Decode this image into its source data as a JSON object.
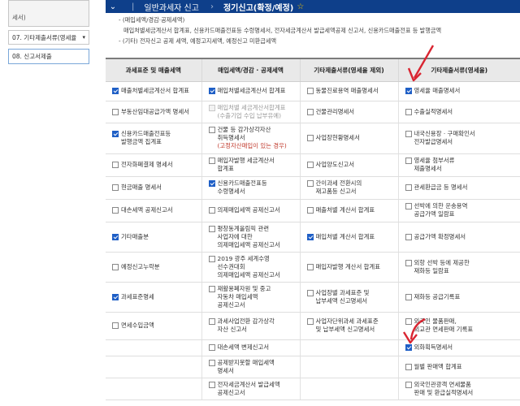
{
  "topbar": {
    "breadcrumb_1": "일반과세자 신고",
    "breadcrumb_2": "정기신고(확정/예정)"
  },
  "sidebar": {
    "item_top": "세서)",
    "item_7": "07. 기타제출서류(영세율",
    "item_8": "08. 신고서제출"
  },
  "notes": {
    "line1": "- (매입세액/경감·공제세액)",
    "line2": "매입처별세금계산서 합계표, 신용카드매출전표등 수령명세서, 전자세금계산서 발급세액공제 신고서, 신용카드매출전표 등 발행금액",
    "line3": "- (기타) 전자신고 공제 세액, 예정고지세액, 예정신고 미환급세액"
  },
  "table": {
    "headers": [
      "과세표준 및 매출세액",
      "매입세액/경감 · 공제세액",
      "기타제출서류(영세율 제외)",
      "기타제출서류(영세율)"
    ],
    "rows": [
      [
        {
          "label": "매출처별세금계산서 합계표",
          "checked": true
        },
        {
          "label": "매입처별세금계산서 합계표",
          "checked": true
        },
        {
          "label": "동물진료용역 매출명세서",
          "checked": false
        },
        {
          "label": "영세율 매출명세서",
          "checked": true
        }
      ],
      [
        {
          "label": "부동산임대공급가액 명세서",
          "checked": false
        },
        {
          "label": "매입처별 세금계산서합계표\n(수출기업 수입 납부유예)",
          "checked": false,
          "disabled": true
        },
        {
          "label": "건물관리명세서",
          "checked": false
        },
        {
          "label": "수출실적명세서",
          "checked": false
        }
      ],
      [
        {
          "label": "신용카드매출전표등\n발행금액 집계표",
          "checked": true
        },
        {
          "label": "건물 등 감가상각자산\n취득명세서",
          "sub": "(고정자산매입이 있는 경우)",
          "checked": false
        },
        {
          "label": "사업장현황명세서",
          "checked": false
        },
        {
          "label": "내국신용장 · 구매확인서\n전자발급명세서",
          "checked": false
        }
      ],
      [
        {
          "label": "전자화폐결제 명세서",
          "checked": false
        },
        {
          "label": "매입자발행 세금계산서\n합계표",
          "checked": false
        },
        {
          "label": "사업양도신고서",
          "checked": false
        },
        {
          "label": "영세율 첨부서류\n제출명세서",
          "checked": false
        }
      ],
      [
        {
          "label": "현금매출 명세서",
          "checked": false
        },
        {
          "label": "신용카드매출전표등\n수령명세서",
          "checked": true
        },
        {
          "label": "간이과세 전환시의\n재고품등 신고서",
          "checked": false
        },
        {
          "label": "관세환급금 등 명세서",
          "checked": false
        }
      ],
      [
        {
          "label": "대손세액 공제신고서",
          "checked": false
        },
        {
          "label": "의제매입세액 공제신고서",
          "checked": false
        },
        {
          "label": "매출처별 계산서 합계표",
          "checked": false
        },
        {
          "label": "선박에 의한 운송용역\n공급가액 일람표",
          "checked": false
        }
      ],
      [
        {
          "label": "기타매출분",
          "checked": true
        },
        {
          "label": "평창동계올림픽 관련\n사업자에 대한\n의제매입세액 공제신고서",
          "checked": false
        },
        {
          "label": "매입처별 계산서 합계표",
          "checked": true
        },
        {
          "label": "공급가액 확정명세서",
          "checked": false
        }
      ],
      [
        {
          "label": "예정신고누락분",
          "checked": false
        },
        {
          "label": "2019 광주 세계수영\n선수권대회\n의제매입세액 공제신고서",
          "checked": false
        },
        {
          "label": "매입자발행 계산서 합계표",
          "checked": false
        },
        {
          "label": "외항 선박 등에 제공한\n재화등 일람표",
          "checked": false
        }
      ],
      [
        {
          "label": "과세표준명세",
          "checked": true
        },
        {
          "label": "재활용폐자원 및 중고\n자동차 매입세액\n공제신고서",
          "checked": false
        },
        {
          "label": "사업장별 과세표준 및\n납부세액 신고명세서",
          "checked": false
        },
        {
          "label": "재화등 공급기록표",
          "checked": false
        }
      ],
      [
        {
          "label": "면세수입금액",
          "checked": false
        },
        {
          "label": "과세사업전환 감가상각\n자산 신고서",
          "checked": false
        },
        {
          "label": "사업자단위과세 과세표준\n및 납부세액 신고명세서",
          "checked": false
        },
        {
          "label": "외국인 물품판매,\n외교관 면세판매 기록표",
          "checked": false
        }
      ],
      [
        {
          "label": "",
          "checked": null
        },
        {
          "label": "대손세액 변제신고서",
          "checked": false
        },
        {
          "label": "",
          "checked": null
        },
        {
          "label": "외화획득명세서",
          "checked": true
        }
      ],
      [
        {
          "label": "",
          "checked": null
        },
        {
          "label": "공제받지못할 매입세액\n명세서",
          "checked": false
        },
        {
          "label": "",
          "checked": null
        },
        {
          "label": "월별 판매액 합계표",
          "checked": false
        }
      ],
      [
        {
          "label": "",
          "checked": null
        },
        {
          "label": "전자세금계산서 발급세액\n공제신고서",
          "checked": false
        },
        {
          "label": "",
          "checked": null
        },
        {
          "label": "외국인관광객 면세물품\n판매 및 환급실적명세서",
          "checked": false
        }
      ]
    ]
  },
  "colors": {
    "topbar": "#0e3f8a",
    "arrow": "#d92531",
    "checked": "#1f5fc6"
  }
}
